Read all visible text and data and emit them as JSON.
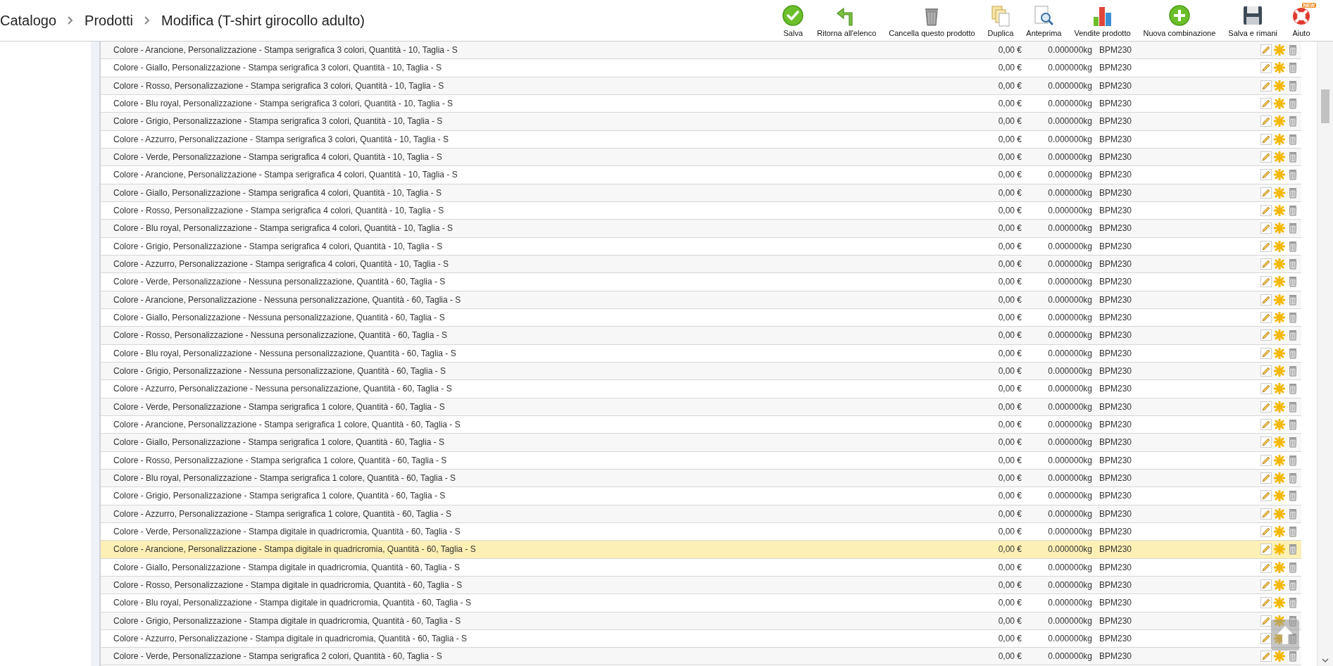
{
  "breadcrumb": [
    "Catalogo",
    "Prodotti",
    "Modifica (T-shirt girocollo adulto)"
  ],
  "toolbar": [
    {
      "kind": "save",
      "label": "Salva"
    },
    {
      "kind": "back",
      "label": "Ritorna all'elenco"
    },
    {
      "kind": "delete",
      "label": "Cancella questo prodotto"
    },
    {
      "kind": "duplicate",
      "label": "Duplica"
    },
    {
      "kind": "preview",
      "label": "Anteprima"
    },
    {
      "kind": "sales",
      "label": "Vendite prodotto"
    },
    {
      "kind": "add",
      "label": "Nuova combinazione"
    },
    {
      "kind": "saveStay",
      "label": "Salva e rimani"
    },
    {
      "kind": "help",
      "label": "Aiuto",
      "badge": "NEW"
    }
  ],
  "rows": [
    {
      "name": "Colore - Arancione, Personalizzazione - Stampa serigrafica 3 colori, Quantità - 10, Taglia - S",
      "price": "0,00 €",
      "weight": "0.000000kg",
      "reference": "BPM230",
      "selected": false
    },
    {
      "name": "Colore - Giallo, Personalizzazione - Stampa serigrafica 3 colori, Quantità - 10, Taglia - S",
      "price": "0,00 €",
      "weight": "0.000000kg",
      "reference": "BPM230",
      "selected": false
    },
    {
      "name": "Colore - Rosso, Personalizzazione - Stampa serigrafica 3 colori, Quantità - 10, Taglia - S",
      "price": "0,00 €",
      "weight": "0.000000kg",
      "reference": "BPM230",
      "selected": false
    },
    {
      "name": "Colore - Blu royal, Personalizzazione - Stampa serigrafica 3 colori, Quantità - 10, Taglia - S",
      "price": "0,00 €",
      "weight": "0.000000kg",
      "reference": "BPM230",
      "selected": false
    },
    {
      "name": "Colore - Grigio, Personalizzazione - Stampa serigrafica 3 colori, Quantità - 10, Taglia - S",
      "price": "0,00 €",
      "weight": "0.000000kg",
      "reference": "BPM230",
      "selected": false
    },
    {
      "name": "Colore - Azzurro, Personalizzazione - Stampa serigrafica 3 colori, Quantità - 10, Taglia - S",
      "price": "0,00 €",
      "weight": "0.000000kg",
      "reference": "BPM230",
      "selected": false
    },
    {
      "name": "Colore - Verde, Personalizzazione - Stampa serigrafica 4 colori, Quantità - 10, Taglia - S",
      "price": "0,00 €",
      "weight": "0.000000kg",
      "reference": "BPM230",
      "selected": false
    },
    {
      "name": "Colore - Arancione, Personalizzazione - Stampa serigrafica 4 colori, Quantità - 10, Taglia - S",
      "price": "0,00 €",
      "weight": "0.000000kg",
      "reference": "BPM230",
      "selected": false
    },
    {
      "name": "Colore - Giallo, Personalizzazione - Stampa serigrafica 4 colori, Quantità - 10, Taglia - S",
      "price": "0,00 €",
      "weight": "0.000000kg",
      "reference": "BPM230",
      "selected": false
    },
    {
      "name": "Colore - Rosso, Personalizzazione - Stampa serigrafica 4 colori, Quantità - 10, Taglia - S",
      "price": "0,00 €",
      "weight": "0.000000kg",
      "reference": "BPM230",
      "selected": false
    },
    {
      "name": "Colore - Blu royal, Personalizzazione - Stampa serigrafica 4 colori, Quantità - 10, Taglia - S",
      "price": "0,00 €",
      "weight": "0.000000kg",
      "reference": "BPM230",
      "selected": false
    },
    {
      "name": "Colore - Grigio, Personalizzazione - Stampa serigrafica 4 colori, Quantità - 10, Taglia - S",
      "price": "0,00 €",
      "weight": "0.000000kg",
      "reference": "BPM230",
      "selected": false
    },
    {
      "name": "Colore - Azzurro, Personalizzazione - Stampa serigrafica 4 colori, Quantità - 10, Taglia - S",
      "price": "0,00 €",
      "weight": "0.000000kg",
      "reference": "BPM230",
      "selected": false
    },
    {
      "name": "Colore - Verde, Personalizzazione - Nessuna personalizzazione, Quantità - 60, Taglia - S",
      "price": "0,00 €",
      "weight": "0.000000kg",
      "reference": "BPM230",
      "selected": false
    },
    {
      "name": "Colore - Arancione, Personalizzazione - Nessuna personalizzazione, Quantità - 60, Taglia - S",
      "price": "0,00 €",
      "weight": "0.000000kg",
      "reference": "BPM230",
      "selected": false
    },
    {
      "name": "Colore - Giallo, Personalizzazione - Nessuna personalizzazione, Quantità - 60, Taglia - S",
      "price": "0,00 €",
      "weight": "0.000000kg",
      "reference": "BPM230",
      "selected": false
    },
    {
      "name": "Colore - Rosso, Personalizzazione - Nessuna personalizzazione, Quantità - 60, Taglia - S",
      "price": "0,00 €",
      "weight": "0.000000kg",
      "reference": "BPM230",
      "selected": false
    },
    {
      "name": "Colore - Blu royal, Personalizzazione - Nessuna personalizzazione, Quantità - 60, Taglia - S",
      "price": "0,00 €",
      "weight": "0.000000kg",
      "reference": "BPM230",
      "selected": false
    },
    {
      "name": "Colore - Grigio, Personalizzazione - Nessuna personalizzazione, Quantità - 60, Taglia - S",
      "price": "0,00 €",
      "weight": "0.000000kg",
      "reference": "BPM230",
      "selected": false
    },
    {
      "name": "Colore - Azzurro, Personalizzazione - Nessuna personalizzazione, Quantità - 60, Taglia - S",
      "price": "0,00 €",
      "weight": "0.000000kg",
      "reference": "BPM230",
      "selected": false
    },
    {
      "name": "Colore - Verde, Personalizzazione - Stampa serigrafica 1 colore, Quantità - 60, Taglia - S",
      "price": "0,00 €",
      "weight": "0.000000kg",
      "reference": "BPM230",
      "selected": false
    },
    {
      "name": "Colore - Arancione, Personalizzazione - Stampa serigrafica 1 colore, Quantità - 60, Taglia - S",
      "price": "0,00 €",
      "weight": "0.000000kg",
      "reference": "BPM230",
      "selected": false
    },
    {
      "name": "Colore - Giallo, Personalizzazione - Stampa serigrafica 1 colore, Quantità - 60, Taglia - S",
      "price": "0,00 €",
      "weight": "0.000000kg",
      "reference": "BPM230",
      "selected": false
    },
    {
      "name": "Colore - Rosso, Personalizzazione - Stampa serigrafica 1 colore, Quantità - 60, Taglia - S",
      "price": "0,00 €",
      "weight": "0.000000kg",
      "reference": "BPM230",
      "selected": false
    },
    {
      "name": "Colore - Blu royal, Personalizzazione - Stampa serigrafica 1 colore, Quantità - 60, Taglia - S",
      "price": "0,00 €",
      "weight": "0.000000kg",
      "reference": "BPM230",
      "selected": false
    },
    {
      "name": "Colore - Grigio, Personalizzazione - Stampa serigrafica 1 colore, Quantità - 60, Taglia - S",
      "price": "0,00 €",
      "weight": "0.000000kg",
      "reference": "BPM230",
      "selected": false
    },
    {
      "name": "Colore - Azzurro, Personalizzazione - Stampa serigrafica 1 colore, Quantità - 60, Taglia - S",
      "price": "0,00 €",
      "weight": "0.000000kg",
      "reference": "BPM230",
      "selected": false
    },
    {
      "name": "Colore - Verde, Personalizzazione - Stampa digitale in quadricromia, Quantità - 60, Taglia - S",
      "price": "0,00 €",
      "weight": "0.000000kg",
      "reference": "BPM230",
      "selected": false
    },
    {
      "name": "Colore - Arancione, Personalizzazione - Stampa digitale in quadricromia, Quantità - 60, Taglia - S",
      "price": "0,00 €",
      "weight": "0.000000kg",
      "reference": "BPM230",
      "selected": true
    },
    {
      "name": "Colore - Giallo, Personalizzazione - Stampa digitale in quadricromia, Quantità - 60, Taglia - S",
      "price": "0,00 €",
      "weight": "0.000000kg",
      "reference": "BPM230",
      "selected": false
    },
    {
      "name": "Colore - Rosso, Personalizzazione - Stampa digitale in quadricromia, Quantità - 60, Taglia - S",
      "price": "0,00 €",
      "weight": "0.000000kg",
      "reference": "BPM230",
      "selected": false
    },
    {
      "name": "Colore - Blu royal, Personalizzazione - Stampa digitale in quadricromia, Quantità - 60, Taglia - S",
      "price": "0,00 €",
      "weight": "0.000000kg",
      "reference": "BPM230",
      "selected": false
    },
    {
      "name": "Colore - Grigio, Personalizzazione - Stampa digitale in quadricromia, Quantità - 60, Taglia - S",
      "price": "0,00 €",
      "weight": "0.000000kg",
      "reference": "BPM230",
      "selected": false
    },
    {
      "name": "Colore - Azzurro, Personalizzazione - Stampa digitale in quadricromia, Quantità - 60, Taglia - S",
      "price": "0,00 €",
      "weight": "0.000000kg",
      "reference": "BPM230",
      "selected": false
    },
    {
      "name": "Colore - Verde, Personalizzazione - Stampa serigrafica 2 colori, Quantità - 60, Taglia - S",
      "price": "0,00 €",
      "weight": "0.000000kg",
      "reference": "BPM230",
      "selected": false
    }
  ]
}
